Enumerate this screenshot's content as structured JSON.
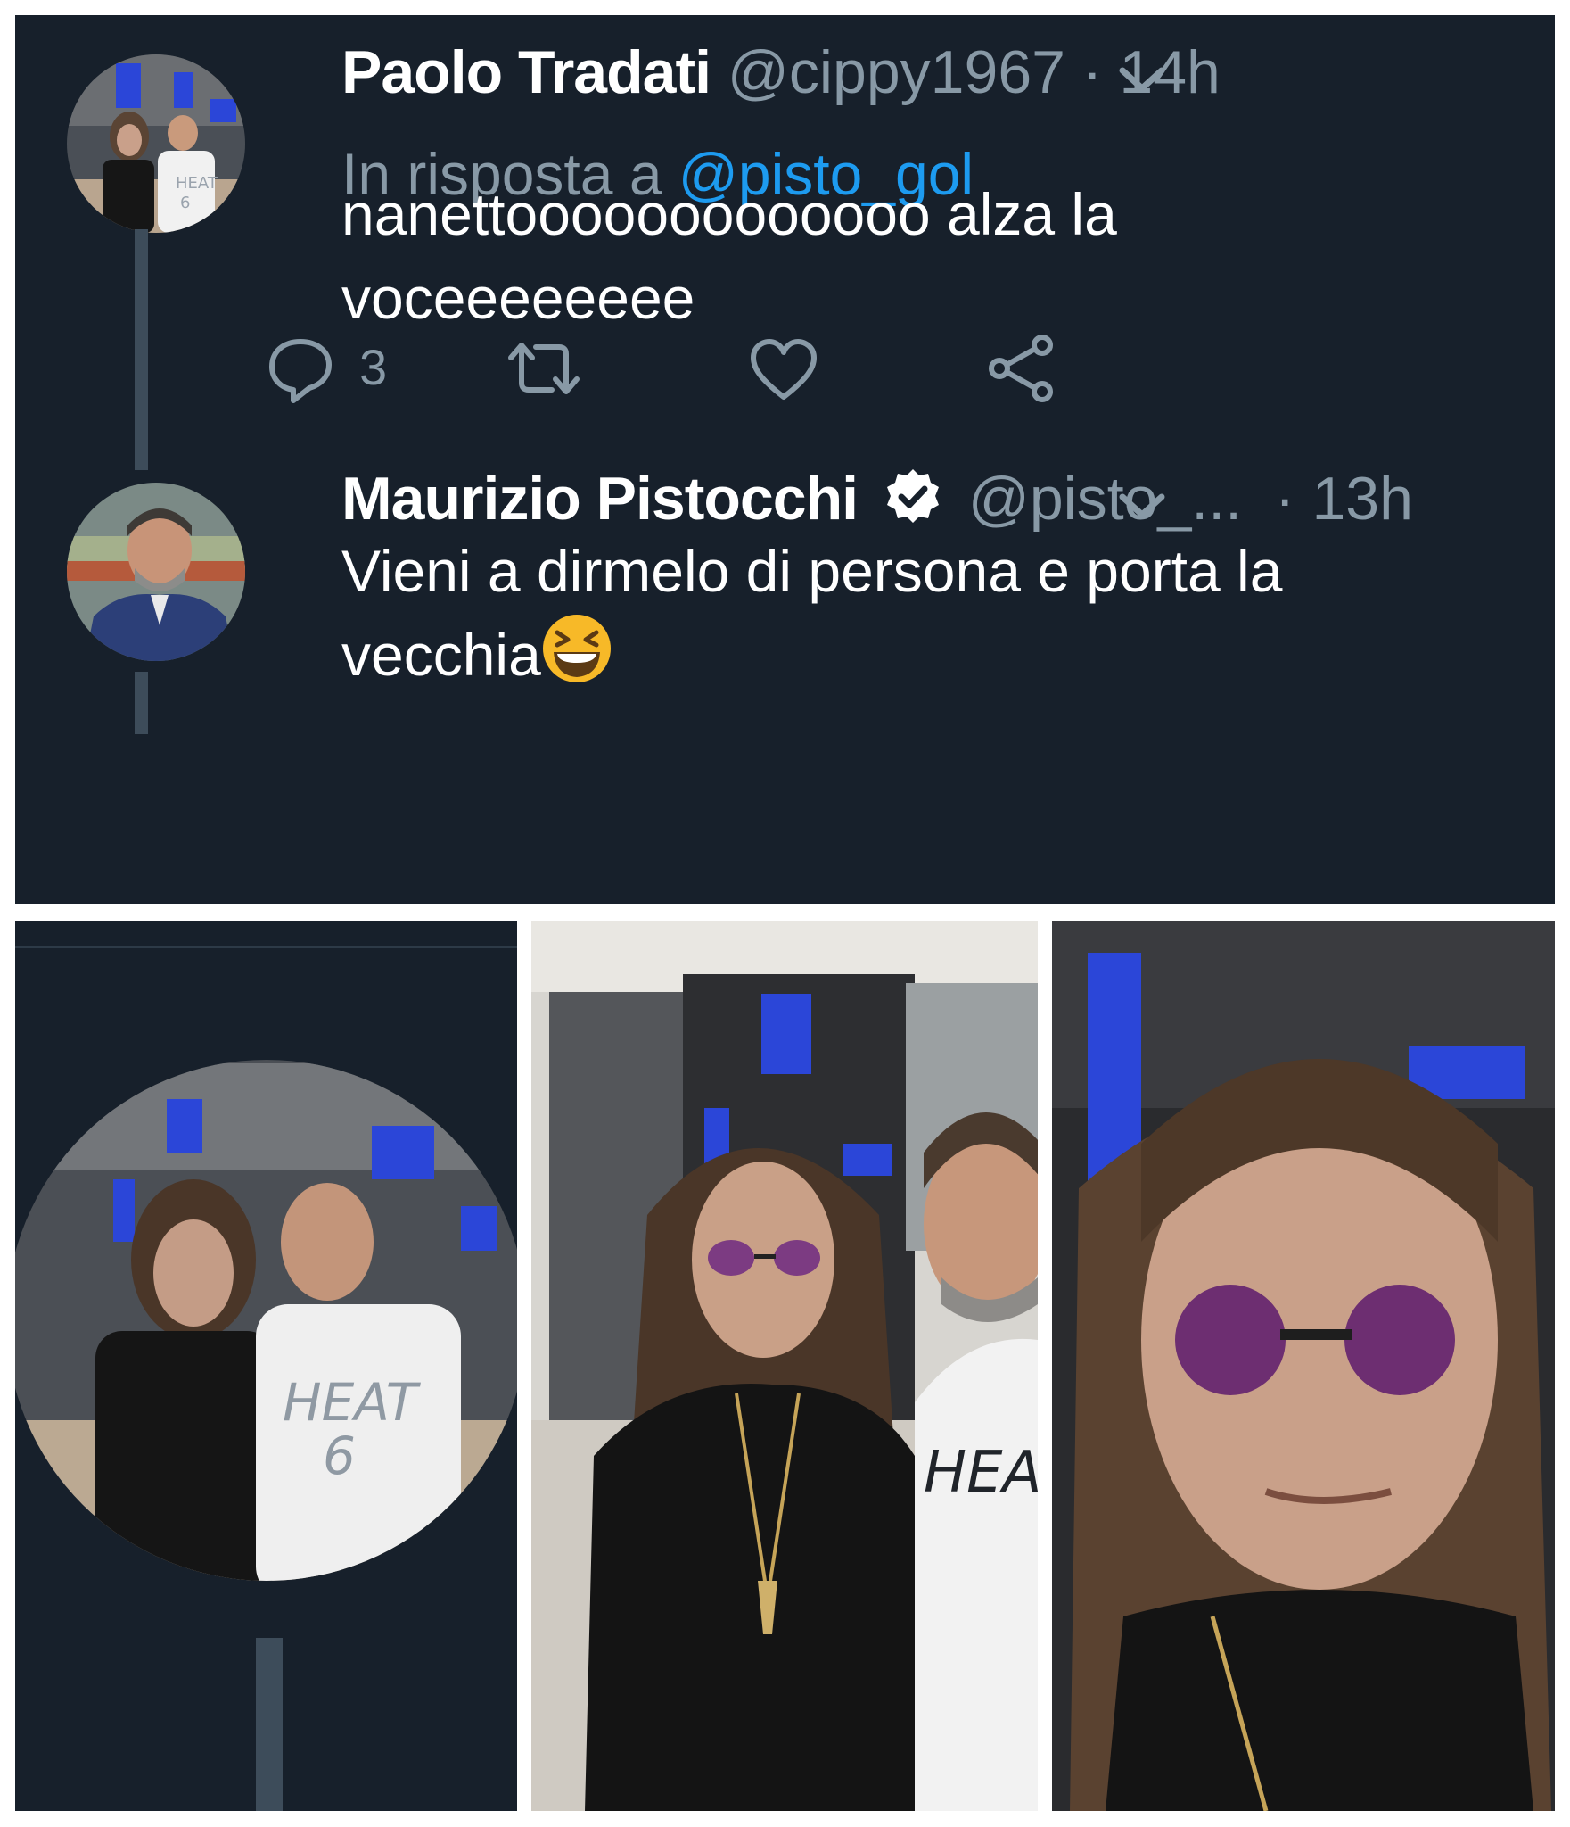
{
  "tweets": [
    {
      "name": "Paolo Tradati",
      "handle": "@cippy1967",
      "dot": "·",
      "time": "14h",
      "reply_label": "In risposta a",
      "reply_mention": "@pisto_gol",
      "text_line1": "nanettooooooooooooo alza la",
      "text_line2": "voceeeeeeee",
      "actions": {
        "reply_count": "3",
        "retweet_count": "",
        "like_count": ""
      },
      "avatar_icon": "avatar-photo-icon"
    },
    {
      "name": "Maurizio Pistocchi",
      "verified": true,
      "handle": "@pisto_...",
      "dot": "·",
      "time": "13h",
      "text_line1": "Vieni a dirmelo di persona e porta la",
      "text_line2": "vecchia",
      "emoji": "grinning-squinting-face-emoji",
      "avatar_icon": "avatar-photo-icon"
    }
  ],
  "icons": {
    "reply": "reply-icon",
    "retweet": "retweet-icon",
    "like": "heart-icon",
    "share": "share-icon",
    "chevron": "chevron-down-icon",
    "verified": "verified-badge-icon"
  },
  "photos": {
    "tile1": "zoomed-avatar-photo",
    "tile2": "original-photo-two-men",
    "tile3": "closeup-photo-man-with-sunglasses"
  },
  "colors": {
    "background": "#17202b",
    "text": "#ffffff",
    "muted": "#8899a6",
    "link": "#1d9bf0",
    "thread_line": "#3d4c5a"
  }
}
